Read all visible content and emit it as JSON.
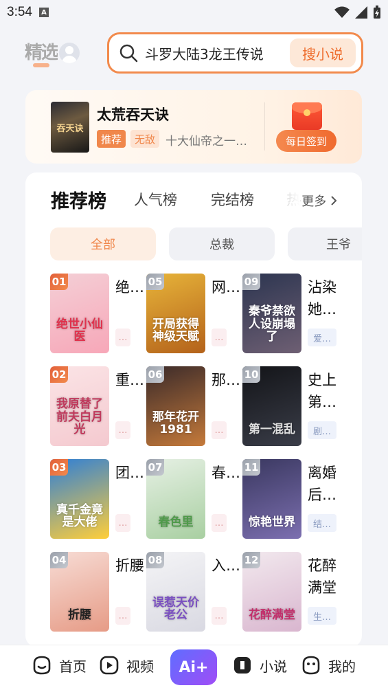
{
  "status": {
    "time": "3:54",
    "sim": "A"
  },
  "header": {
    "tab_label": "精选",
    "search_text": "斗罗大陆3龙王传说",
    "search_button": "搜小说"
  },
  "featured": {
    "cover_text": "吞天诀",
    "title": "太荒吞天诀",
    "tag1": "推荐",
    "tag2": "无敌",
    "desc": "十大仙帝之一…",
    "signin_label": "每日签到"
  },
  "rank": {
    "tabs": [
      "推荐榜",
      "人气榜",
      "完结榜",
      "热"
    ],
    "more_label": "更多",
    "chips": [
      "全部",
      "总裁",
      "王爷"
    ]
  },
  "books": [
    {
      "num": "01",
      "cover": "绝世小仙医",
      "title": "绝…",
      "badge": "…",
      "colors": [
        "#f4cfd6",
        "#f7a7b8"
      ],
      "fg": "#e0314c"
    },
    {
      "num": "02",
      "cover": "我原替了前夫白月光",
      "title": "重…",
      "badge": "…",
      "colors": [
        "#fbe4e6",
        "#f4c9cf"
      ],
      "fg": "#c0395c"
    },
    {
      "num": "03",
      "cover": "真千金竟是大佬",
      "title": "团…",
      "badge": "…",
      "colors": [
        "#2f7fd6",
        "#ffce3a"
      ],
      "fg": "#fff"
    },
    {
      "num": "04",
      "cover": "折腰",
      "title": "折腰",
      "badge": "…",
      "colors": [
        "#f7dcd5",
        "#e69b86"
      ],
      "fg": "#222"
    },
    {
      "num": "05",
      "cover": "开局获得神级天赋",
      "title": "网…",
      "badge": "…",
      "colors": [
        "#e7b43a",
        "#b4621a"
      ],
      "fg": "#fff"
    },
    {
      "num": "06",
      "cover": "那年花开1981",
      "title": "那…",
      "badge": "…",
      "colors": [
        "#3a2a2a",
        "#c57a3a"
      ],
      "fg": "#fff"
    },
    {
      "num": "07",
      "cover": "春色里",
      "title": "春…",
      "badge": "…",
      "colors": [
        "#e6f0e4",
        "#a8cfa1"
      ],
      "fg": "#4f9a4a"
    },
    {
      "num": "08",
      "cover": "误惹天价老公",
      "title": "入…",
      "badge": "…",
      "colors": [
        "#f4f4f6",
        "#d9d9e2"
      ],
      "fg": "#7a4fc1"
    },
    {
      "num": "09",
      "cover": "秦爷禁欲人设崩塌了",
      "title": "沾染她…",
      "badge": "爱…",
      "colors": [
        "#2c3550",
        "#6e5f73"
      ],
      "fg": "#fff"
    },
    {
      "num": "10",
      "cover": "第一混乱",
      "title": "史上第…",
      "badge": "剧…",
      "colors": [
        "#131418",
        "#3a3d48"
      ],
      "fg": "#ddd"
    },
    {
      "num": "11",
      "cover": "惊艳世界",
      "title": "离婚后…",
      "badge": "结…",
      "colors": [
        "#3a3860",
        "#7c6fb0"
      ],
      "fg": "#fff"
    },
    {
      "num": "12",
      "cover": "花醉满堂",
      "title": "花醉满堂",
      "badge": "生…",
      "colors": [
        "#f2e9ee",
        "#d9b6cf"
      ],
      "fg": "#c32f6b"
    }
  ],
  "nav": {
    "home": "首页",
    "video": "视频",
    "ai": "Ai+",
    "novel": "小说",
    "me": "我的"
  }
}
